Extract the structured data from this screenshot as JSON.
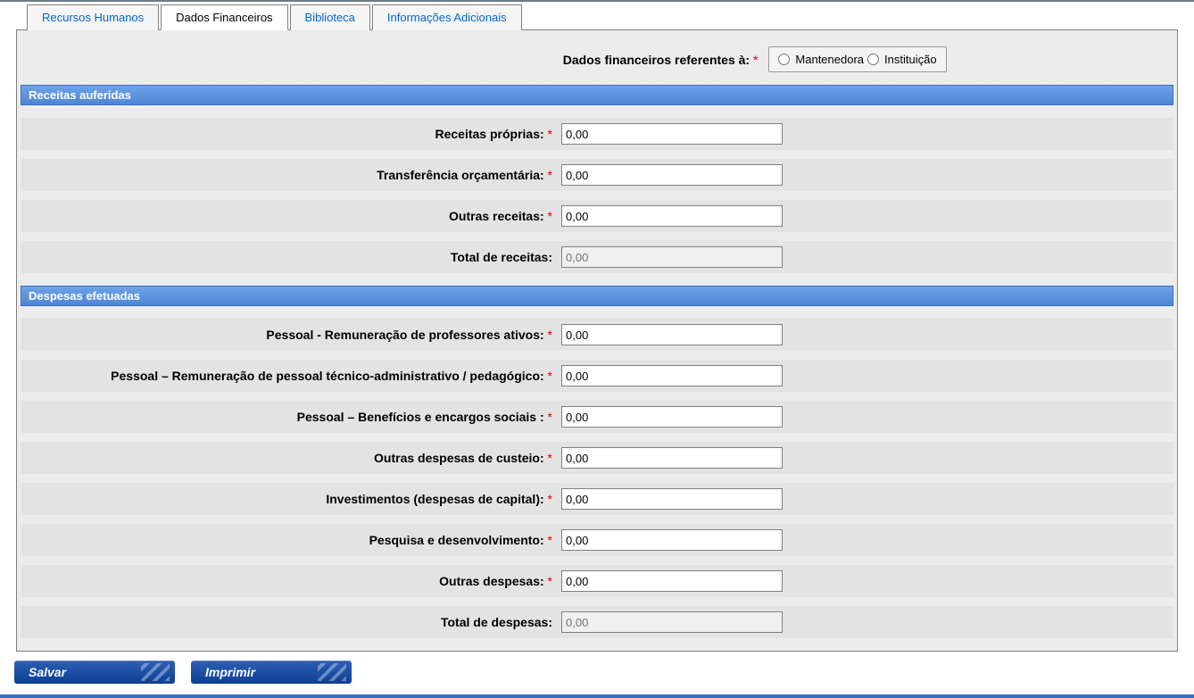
{
  "tabs": {
    "recursos_humanos": "Recursos Humanos",
    "dados_financeiros": "Dados Financeiros",
    "biblioteca": "Biblioteca",
    "informacoes_adicionais": "Informações Adicionais"
  },
  "top": {
    "label": "Dados financeiros referentes à:",
    "option_mantenedora": "Mantenedora",
    "option_instituicao": "Instituição"
  },
  "receitas": {
    "header": "Receitas auferidas",
    "proprias_label": "Receitas próprias:",
    "proprias_value": "0,00",
    "transferencia_label": "Transferência orçamentária:",
    "transferencia_value": "0,00",
    "outras_label": "Outras receitas:",
    "outras_value": "0,00",
    "total_label": "Total de receitas:",
    "total_placeholder": "0,00"
  },
  "despesas": {
    "header": "Despesas efetuadas",
    "professores_label": "Pessoal - Remuneração de professores ativos:",
    "professores_value": "0,00",
    "tecnico_label": "Pessoal – Remuneração de pessoal técnico-administrativo / pedagógico:",
    "tecnico_value": "0,00",
    "beneficios_label": "Pessoal – Benefícios e encargos sociais :",
    "beneficios_value": "0,00",
    "custeio_label": "Outras despesas de custeio:",
    "custeio_value": "0,00",
    "investimentos_label": "Investimentos (despesas de capital):",
    "investimentos_value": "0,00",
    "pesquisa_label": "Pesquisa e desenvolvimento:",
    "pesquisa_value": "0,00",
    "outras_label": "Outras despesas:",
    "outras_value": "0,00",
    "total_label": "Total de despesas:",
    "total_placeholder": "0,00"
  },
  "buttons": {
    "salvar": "Salvar",
    "imprimir": "Imprimir"
  },
  "asterisk": "*"
}
